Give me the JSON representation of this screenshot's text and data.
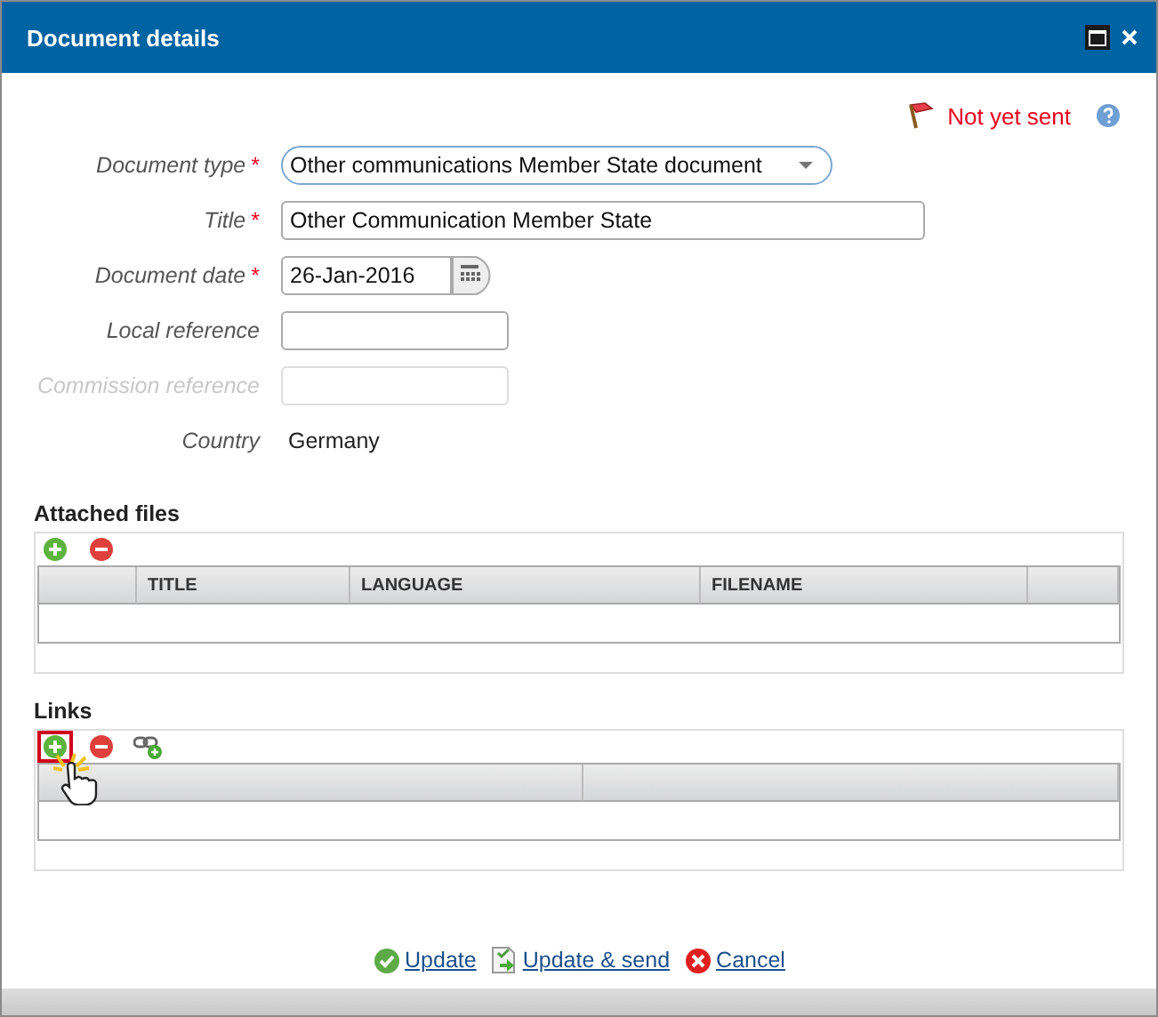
{
  "window": {
    "title": "Document details"
  },
  "status": {
    "text": "Not yet sent"
  },
  "fields": [
    {
      "label": "Document type",
      "required_mark": "*",
      "kind": "select",
      "value": "Other communications Member State document",
      "disabled": false
    },
    {
      "label": "Title",
      "required_mark": "*",
      "kind": "text",
      "value": "Other Communication Member  State",
      "disabled": false
    },
    {
      "label": "Document date",
      "required_mark": "*",
      "kind": "date",
      "value": "26-Jan-2016",
      "disabled": false
    },
    {
      "label": "Local reference",
      "kind": "text",
      "disabled": false
    },
    {
      "label": "Commission reference",
      "kind": "text",
      "disabled": true
    },
    {
      "label": "Country",
      "kind": "static",
      "value": "Germany",
      "disabled": false
    }
  ],
  "sections": [
    {
      "title": "Attached files",
      "toolbar": [
        {
          "kind": "add",
          "highlighted": false
        },
        {
          "kind": "remove",
          "highlighted": false
        }
      ],
      "columns": [
        "",
        "TITLE",
        "LANGUAGE",
        "FILENAME",
        ""
      ]
    },
    {
      "title": "Links",
      "toolbar": [
        {
          "kind": "add",
          "highlighted": true
        },
        {
          "kind": "remove",
          "highlighted": false
        },
        {
          "kind": "link",
          "highlighted": false
        }
      ],
      "columns": [
        "",
        ""
      ]
    }
  ],
  "actions": [
    {
      "kind": "update",
      "label": "Update"
    },
    {
      "kind": "send",
      "label": "Update & send"
    },
    {
      "kind": "cancel",
      "label": "Cancel"
    }
  ]
}
